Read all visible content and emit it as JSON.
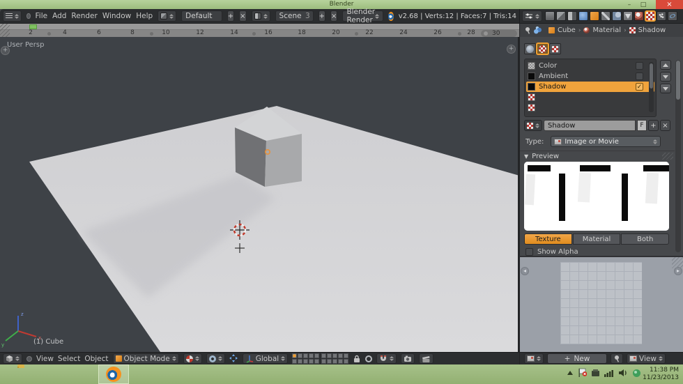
{
  "window": {
    "title": "Blender"
  },
  "glyphs": {
    "minimize": "–",
    "maximize": "□",
    "close": "×",
    "plus": "+",
    "x": "×",
    "sep": "›",
    "collapse": "▼",
    "check": "✓"
  },
  "menubar": {
    "menus": [
      {
        "label": "File"
      },
      {
        "label": "Add"
      },
      {
        "label": "Render"
      },
      {
        "label": "Window"
      },
      {
        "label": "Help"
      }
    ],
    "layout": "Default",
    "scene": "Scene",
    "scene_count": "3",
    "engine": "Blender Render",
    "stats": "v2.68 | Verts:12 | Faces:7 | Tris:14"
  },
  "timeline": {
    "frames": [
      "2",
      "4",
      "6",
      "8",
      "10",
      "12",
      "14",
      "16",
      "18",
      "20",
      "22",
      "24",
      "26",
      "28"
    ],
    "end": "30"
  },
  "viewport": {
    "view": "User Persp",
    "object": "(1) Cube"
  },
  "view3d": {
    "menus": [
      {
        "label": "View"
      },
      {
        "label": "Select"
      },
      {
        "label": "Object"
      }
    ],
    "mode": "Object Mode",
    "orientation": "Global"
  },
  "props": {
    "breadcrumb": {
      "object": "Cube",
      "material": "Material",
      "texture": "Shadow"
    },
    "slots": [
      {
        "label": "Color"
      },
      {
        "label": "Ambient"
      },
      {
        "label": "Shadow"
      }
    ],
    "name": "Shadow",
    "fake_user": "F",
    "type_label": "Type:",
    "type": "Image or Movie",
    "preview_title": "Preview",
    "preview_tabs": [
      {
        "label": "Texture"
      },
      {
        "label": "Material"
      },
      {
        "label": "Both"
      }
    ],
    "show_alpha": "Show Alpha"
  },
  "image_editor": {
    "new": "New",
    "view": "View"
  },
  "taskbar": {
    "time": "11:38 PM",
    "date": "11/23/2013"
  }
}
